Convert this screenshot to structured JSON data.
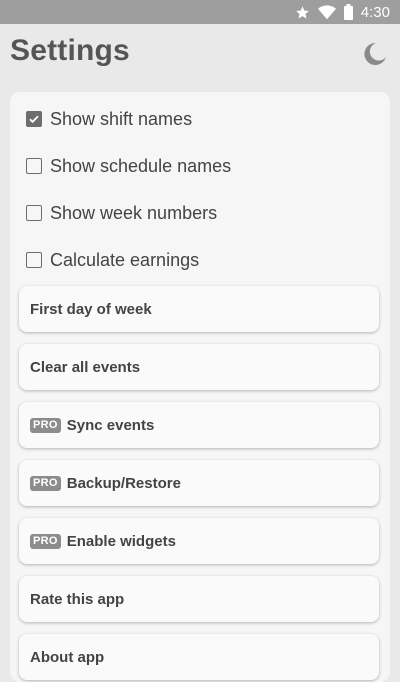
{
  "status_bar": {
    "time": "4:30",
    "icons": [
      "star-icon",
      "wifi-icon",
      "battery-icon"
    ]
  },
  "header": {
    "title": "Settings",
    "theme_icon": "moon-icon"
  },
  "checkboxes": [
    {
      "label": "Show shift names",
      "checked": true
    },
    {
      "label": "Show schedule names",
      "checked": false
    },
    {
      "label": "Show week numbers",
      "checked": false
    },
    {
      "label": "Calculate earnings",
      "checked": false
    }
  ],
  "items": [
    {
      "label": "First day of week",
      "pro": false
    },
    {
      "label": "Clear all events",
      "pro": false
    },
    {
      "label": "Sync events",
      "pro": true,
      "badge": "PRO"
    },
    {
      "label": "Backup/Restore",
      "pro": true,
      "badge": "PRO"
    },
    {
      "label": "Enable widgets",
      "pro": true,
      "badge": "PRO"
    },
    {
      "label": "Rate this app",
      "pro": false
    },
    {
      "label": "About app",
      "pro": false
    }
  ],
  "colors": {
    "status_bar": "#9e9e9e",
    "background": "#e9e9e9",
    "card": "#f6f6f6",
    "pro_badge": "#8c8c8c"
  }
}
